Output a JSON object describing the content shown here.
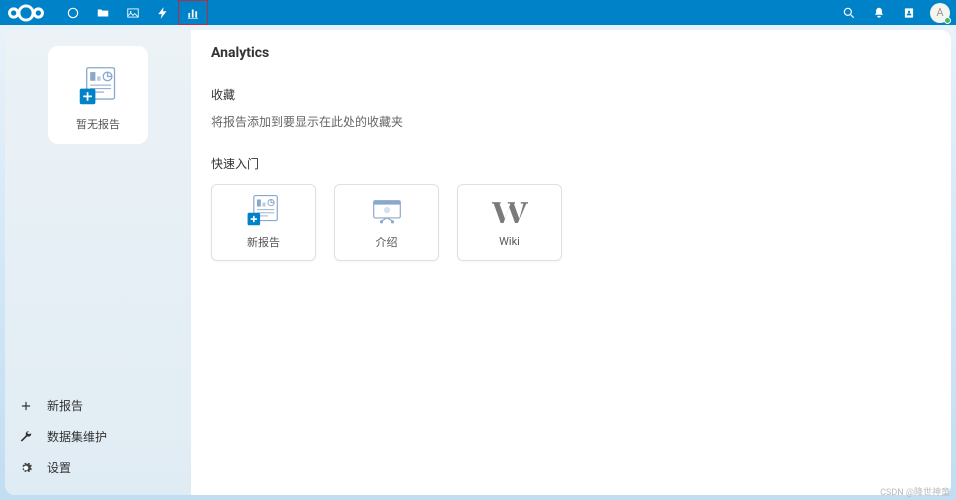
{
  "colors": {
    "primary": "#0082c9",
    "accent": "#7fa6d6"
  },
  "header": {
    "avatar_initial": "A"
  },
  "sidebar": {
    "no_report": {
      "label": "暂无报告"
    },
    "bottom_items": [
      {
        "icon": "plus",
        "label": "新报告"
      },
      {
        "icon": "wrench",
        "label": "数据集维护"
      },
      {
        "icon": "gear",
        "label": "设置"
      }
    ]
  },
  "main": {
    "title": "Analytics",
    "favorites": {
      "title": "收藏",
      "desc": "将报告添加到要显示在此处的收藏夹"
    },
    "quickstart": {
      "title": "快速入门",
      "cards": [
        {
          "icon": "report",
          "label": "新报告"
        },
        {
          "icon": "presentation",
          "label": "介绍"
        },
        {
          "icon": "wiki",
          "label": "Wiki"
        }
      ]
    }
  },
  "watermark": "CSDN @降世神童"
}
